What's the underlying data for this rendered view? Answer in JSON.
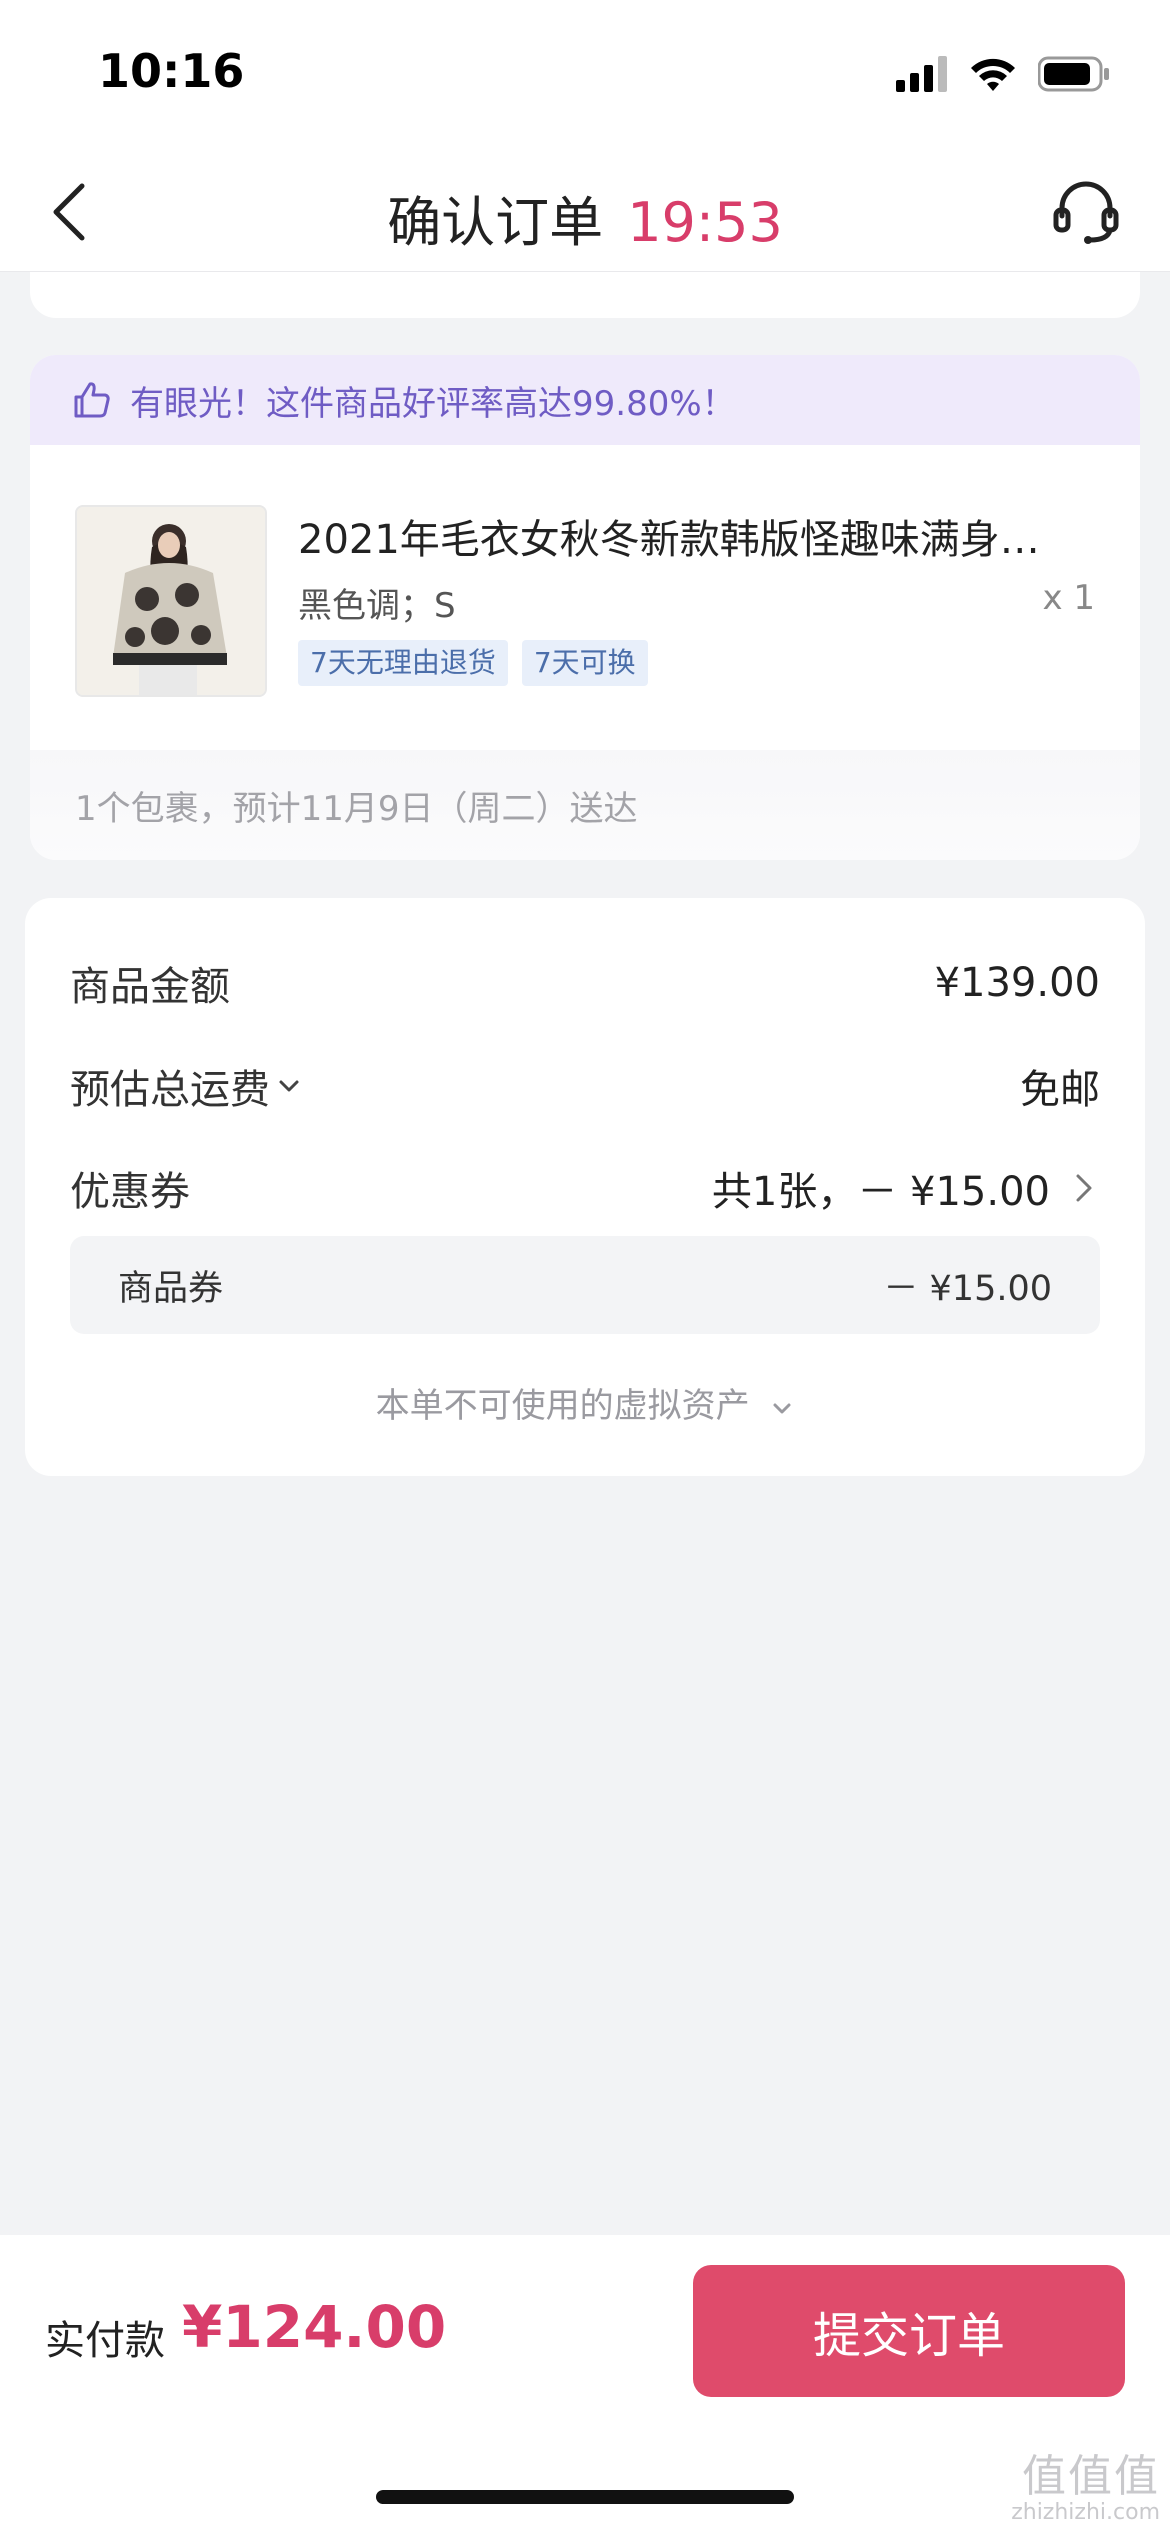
{
  "status_bar": {
    "time": "10:16"
  },
  "nav": {
    "title": "确认订单",
    "timer": "19:53"
  },
  "product_card": {
    "praise_banner": "有眼光！这件商品好评率高达99.80%！",
    "title": "2021年毛衣女秋冬新款韩版怪趣味满身…",
    "spec": "黑色调；S",
    "quantity": "x 1",
    "tags": [
      "7天无理由退货",
      "7天可换"
    ],
    "delivery": "1个包裹，预计11月9日（周二）送达"
  },
  "price_card": {
    "goods_amount_label": "商品金额",
    "goods_amount_value": "¥139.00",
    "shipping_label": "预估总运费",
    "shipping_value": "免邮",
    "coupon_label": "优惠券",
    "coupon_value": "共1张，－ ¥15.00",
    "coupon_sub_label": "商品券",
    "coupon_sub_value": "－ ¥15.00",
    "virtual_assets": "本单不可使用的虚拟资产"
  },
  "bottom_bar": {
    "pay_label": "实付款",
    "pay_amount": "¥124.00",
    "submit_label": "提交订单"
  },
  "watermark": {
    "chars": "值值值",
    "url": "zhizhizhi.com"
  },
  "colors": {
    "accent": "#df4b6b",
    "price": "#d83d6a",
    "praise": "#6f5cc4",
    "tag_text": "#4b6eaa"
  }
}
